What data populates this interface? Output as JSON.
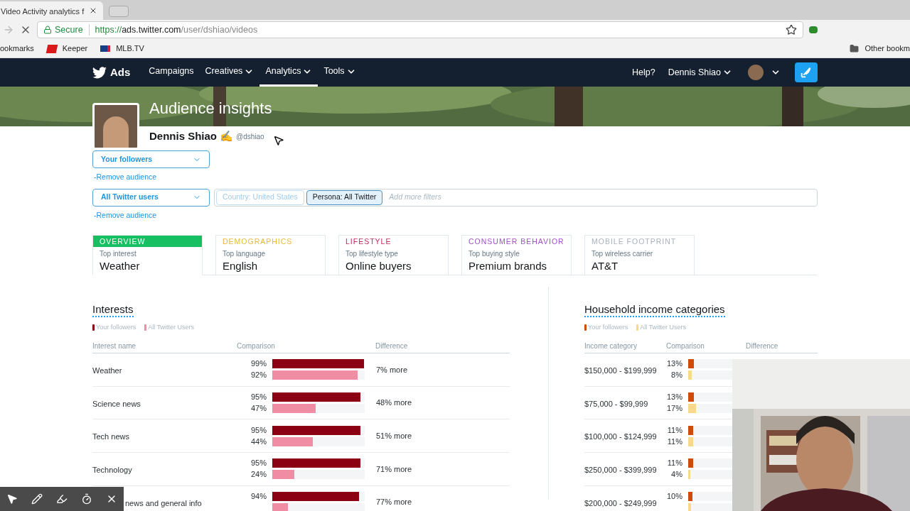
{
  "browser": {
    "tab_title": "Video Activity analytics f",
    "secure": "Secure",
    "url_scheme": "https://",
    "url_host": "ads.twitter.com",
    "url_path": "/user/dshiao/videos",
    "bookmarks": [
      "ookmarks",
      "Keeper",
      "MLB.TV"
    ],
    "other_bookmarks": "Other bookm"
  },
  "nav": {
    "brand": "Ads",
    "items": [
      {
        "label": "Campaigns",
        "selected": false,
        "dropdown": false
      },
      {
        "label": "Creatives",
        "selected": false,
        "dropdown": true
      },
      {
        "label": "Analytics",
        "selected": true,
        "dropdown": true
      },
      {
        "label": "Tools",
        "selected": false,
        "dropdown": true
      }
    ],
    "help": "Help?",
    "user": "Dennis Shiao"
  },
  "header": {
    "title": "Audience insights",
    "name": "Dennis Shiao",
    "emoji": "✍",
    "handle": "@dshiao"
  },
  "audiences": [
    {
      "label": "Your followers",
      "remove": "-Remove audience"
    },
    {
      "label": "All Twitter users",
      "remove": "-Remove audience"
    }
  ],
  "filters": [
    {
      "label": "Country: United States",
      "selected": false
    },
    {
      "label": "Persona: All Twitter",
      "selected": true
    }
  ],
  "filter_placeholder": "Add more filters",
  "tabs": [
    {
      "category": "OVERVIEW",
      "color": "#17bf63",
      "selected": true,
      "caption": "Top interest",
      "value": "Weather"
    },
    {
      "category": "DEMOGRAPHICS",
      "color": "#e8b93a",
      "selected": false,
      "caption": "Top language",
      "value": "English"
    },
    {
      "category": "LIFESTYLE",
      "color": "#c4285a",
      "selected": false,
      "caption": "Top lifestyle type",
      "value": "Online buyers"
    },
    {
      "category": "CONSUMER BEHAVIOR",
      "color": "#a050c8",
      "selected": false,
      "caption": "Top buying style",
      "value": "Premium brands"
    },
    {
      "category": "MOBILE FOOTPRINT",
      "color": "#aab2bb",
      "selected": false,
      "caption": "Top wireless carrier",
      "value": "AT&T"
    }
  ],
  "interests": {
    "title": "Interests",
    "legend": [
      {
        "label": "Your followers",
        "color": "#8b0012"
      },
      {
        "label": "All Twitter Users",
        "color": "#f08ca4"
      }
    ],
    "columns": [
      "Interest name",
      "Comparison",
      "Difference"
    ],
    "rows": [
      {
        "name": "Weather",
        "followers": {
          "text": "99%",
          "level": 0.99
        },
        "all": {
          "text": "92%",
          "level": 0.92
        },
        "difference": "7% more"
      },
      {
        "name": "Science news",
        "followers": {
          "text": "95%",
          "level": 0.95
        },
        "all": {
          "text": "47%",
          "level": 0.47
        },
        "difference": "48% more"
      },
      {
        "name": "Tech news",
        "followers": {
          "text": "95%",
          "level": 0.95
        },
        "all": {
          "text": "44%",
          "level": 0.44
        },
        "difference": "51% more"
      },
      {
        "name": "Technology",
        "followers": {
          "text": "95%",
          "level": 0.95
        },
        "all": {
          "text": "24%",
          "level": 0.24
        },
        "difference": "71% more"
      },
      {
        "name": "news and general info",
        "covered_start": true,
        "followers": {
          "text": "94%",
          "level": 0.94
        },
        "all": {
          "level": 0.17
        },
        "difference": "77% more"
      }
    ]
  },
  "income": {
    "title": "Household income categories",
    "legend": [
      {
        "label": "Your followers",
        "color": "#d04a0a"
      },
      {
        "label": "All Twitter Users",
        "color": "#f8d88a"
      }
    ],
    "columns": [
      "Income category",
      "Comparison",
      "Difference"
    ],
    "rows": [
      {
        "name": "$150,000 - $199,999",
        "followers": {
          "text": "13%",
          "level": 0.13
        },
        "all": {
          "text": "8%",
          "level": 0.08
        }
      },
      {
        "name": "$75,000 - $99,999",
        "followers": {
          "text": "13%",
          "level": 0.13
        },
        "all": {
          "text": "17%",
          "level": 0.17
        }
      },
      {
        "name": "$100,000 - $124,999",
        "followers": {
          "text": "11%",
          "level": 0.11
        },
        "all": {
          "text": "11%",
          "level": 0.11
        }
      },
      {
        "name": "$250,000 - $399,999",
        "followers": {
          "text": "11%",
          "level": 0.11
        },
        "all": {
          "text": "4%",
          "level": 0.04
        }
      },
      {
        "name": "$200,000 - $249,999",
        "followers": {
          "text": "10%",
          "level": 0.1
        },
        "all": {
          "level": 0.07
        }
      }
    ]
  }
}
